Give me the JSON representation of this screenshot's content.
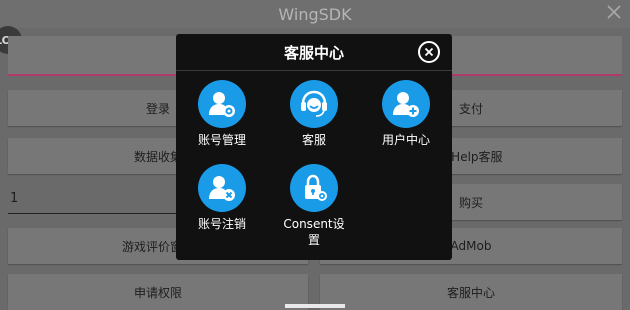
{
  "app": {
    "title": "WingSDK",
    "log_badge": "LOG"
  },
  "background": {
    "row1": {
      "left": "登录",
      "right": "支付"
    },
    "row2": {
      "left": "数据收集",
      "right": "AIHelp客服"
    },
    "row3": {
      "number_value": "1",
      "right": "购买"
    },
    "row4": {
      "left": "游戏评价窗口",
      "right": "AdMob"
    },
    "row5": {
      "left": "申请权限",
      "right": "客服中心"
    }
  },
  "dialog": {
    "title": "客服中心",
    "items": [
      {
        "label": "账号管理",
        "icon": "account-settings-icon"
      },
      {
        "label": "客服",
        "icon": "headset-support-icon"
      },
      {
        "label": "用户中心",
        "icon": "user-add-icon"
      },
      {
        "label": "账号注销",
        "icon": "account-delete-icon"
      },
      {
        "label": "Consent设置",
        "icon": "lock-settings-icon"
      }
    ]
  },
  "colors": {
    "accent": "#1a9be8",
    "underline": "#b03a6a",
    "dialog_bg": "#111111"
  }
}
